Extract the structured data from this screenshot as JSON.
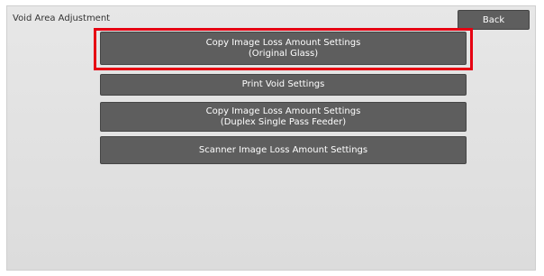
{
  "header": {
    "title": "Void Area Adjustment",
    "back_label": "Back"
  },
  "menu": {
    "items": [
      {
        "line1": "Copy Image Loss Amount Settings",
        "line2": "(Original Glass)"
      },
      {
        "line1": "Print Void Settings",
        "line2": ""
      },
      {
        "line1": "Copy Image Loss Amount Settings",
        "line2": "(Duplex Single Pass Feeder)"
      },
      {
        "line1": "Scanner Image Loss Amount Settings",
        "line2": ""
      }
    ]
  },
  "colors": {
    "highlight": "#e60012",
    "button": "#5e5e5e",
    "background": "#e0e0e0"
  }
}
